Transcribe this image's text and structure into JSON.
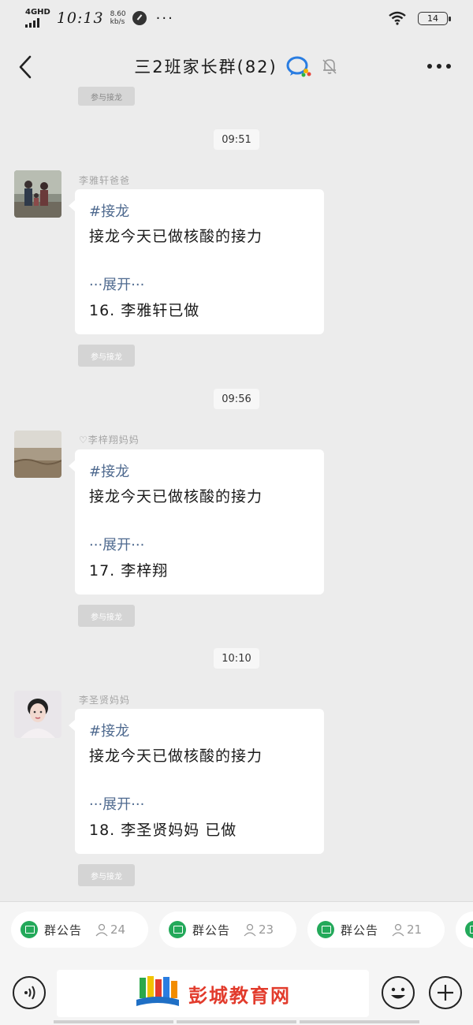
{
  "status_bar": {
    "network": "4GHD",
    "time": "10:13",
    "speed_value": "8.60",
    "speed_unit": "kb/s",
    "dots": "···",
    "battery": "14"
  },
  "header": {
    "title": "三2班家长群(82)"
  },
  "partial_join_label": "参与接龙",
  "messages": [
    {
      "time": "09:51",
      "sender": "李雅轩爸爸",
      "tag": "#接龙",
      "text": "接龙今天已做核酸的接力",
      "expand": "···展开···",
      "entry": "16. 李雅轩已做",
      "join_label": "参与接龙"
    },
    {
      "time": "09:56",
      "sender": "♡李梓翔妈妈",
      "tag": "#接龙",
      "text": "接龙今天已做核酸的接力",
      "expand": "···展开···",
      "entry": "17. 李梓翔",
      "join_label": "参与接龙"
    },
    {
      "time": "10:10",
      "sender": "李圣贤妈妈",
      "tag": "#接龙",
      "text": "接龙今天已做核酸的接力",
      "expand": "···展开···",
      "entry": "18. 李圣贤妈妈 已做",
      "join_label": "参与接龙"
    }
  ],
  "notice_chips": [
    {
      "label": "群公告",
      "count": "24"
    },
    {
      "label": "群公告",
      "count": "23"
    },
    {
      "label": "群公告",
      "count": "21"
    }
  ],
  "input_bar": {
    "watermark_text": "彭城教育网"
  },
  "colors": {
    "background": "#ececec",
    "bubble": "#ffffff",
    "link_blue": "#4f6a8f",
    "chip_green": "#23a95a",
    "logo_red": "#e23b2c"
  },
  "icons": [
    "back-arrow-icon",
    "chat-group-icon",
    "mute-bell-icon",
    "more-icon",
    "megaphone-icon",
    "person-icon",
    "voice-icon",
    "emoji-icon",
    "plus-icon",
    "book-logo-icon"
  ]
}
